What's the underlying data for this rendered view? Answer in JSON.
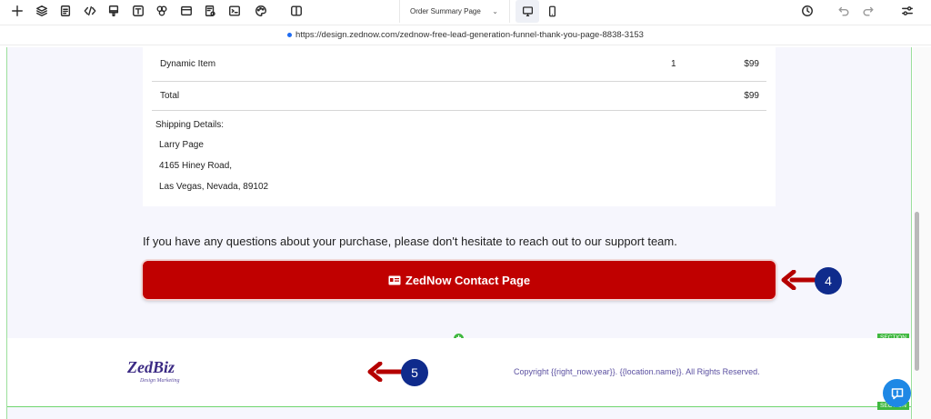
{
  "toolbar": {
    "left_icons": [
      "plus-icon",
      "layers-icon",
      "pages-icon",
      "code-icon",
      "paint-icon",
      "text-icon",
      "shapes-icon",
      "layout-icon",
      "form-icon",
      "terminal-icon",
      "palette-icon"
    ],
    "panel_icon": "split-panel-icon",
    "page_select": {
      "value": "Order Summary Page"
    },
    "devices": [
      {
        "name": "desktop-icon",
        "active": true
      },
      {
        "name": "mobile-icon",
        "active": false
      }
    ],
    "right_icons": [
      "history-icon",
      "undo-icon",
      "redo-icon",
      "settings-icon"
    ]
  },
  "url": {
    "text": "https://design.zednow.com/zednow-free-lead-generation-funnel-thank-you-page-8838-3153"
  },
  "order": {
    "items": [
      {
        "name": "Dynamic Item",
        "qty": "1",
        "price": "$99"
      }
    ],
    "total": {
      "label": "Total",
      "price": "$99"
    },
    "shipping": {
      "label": "Shipping Details:",
      "lines": [
        "Larry Page",
        "4165 Hiney Road,",
        "Las Vegas, Nevada, 89102"
      ]
    }
  },
  "support": {
    "text": "If you have any questions about your purchase, please don't hesitate to reach out to our support team."
  },
  "cta": {
    "label": "ZedNow Contact Page",
    "color": "#c00000"
  },
  "annotations": [
    {
      "number": "4"
    },
    {
      "number": "5"
    }
  ],
  "section": {
    "tag": "SECTION",
    "tag2": "SECTION"
  },
  "footer": {
    "logo": {
      "main": "ZedBiz",
      "sub": "Design Marketing"
    },
    "copyright": "Copyright {{right_now.year}}. {{location.name}}. All Rights Reserved."
  },
  "colors": {
    "accent_green": "#3fb83f",
    "annotation_blue": "#0f2b8c",
    "arrow_red": "#b50000"
  }
}
